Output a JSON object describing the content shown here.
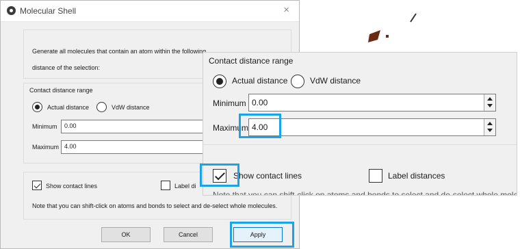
{
  "window": {
    "title": "Molecular Shell",
    "close_glyph": "×",
    "icon": "molecule-icon"
  },
  "intro": {
    "line1": "Generate all molecules that contain an atom within the following",
    "line2": "distance of the selection:"
  },
  "contact_range": {
    "title": "Contact distance range",
    "actual_label": "Actual distance",
    "vdw_label": "VdW distance",
    "selected": "actual",
    "minimum_label": "Minimum",
    "minimum_value": "0.00",
    "maximum_label": "Maximum",
    "maximum_value": "4.00",
    "maximum_label_zoom": "Maximum"
  },
  "options": {
    "show_contact_lines_label": "Show contact lines",
    "show_contact_lines_checked": true,
    "label_distances_label": "Label distances",
    "label_distances_short": "Label di",
    "label_distances_checked": false,
    "note": "Note that you can shift-click on atoms and bonds to select and de-select whole molecules.",
    "show_zoom_prefix": "Sh",
    "show_zoom_suffix": "w contact lines"
  },
  "buttons": {
    "ok": "OK",
    "cancel": "Cancel",
    "apply": "Apply"
  },
  "colors": {
    "highlight": "#1aa3e8",
    "molecule_fragment": "#6b2a14"
  }
}
